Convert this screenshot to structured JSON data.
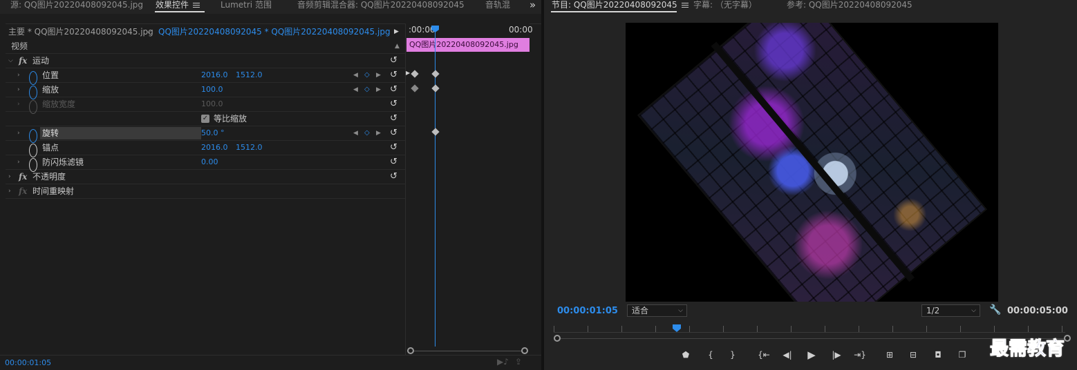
{
  "tabs_left": {
    "source": "源: QQ图片20220408092045.jpg",
    "effect_controls": "效果控件",
    "lumetri": "Lumetri 范围",
    "audio_clip_mixer": "音频剪辑混合器: QQ图片20220408092045",
    "audio_track": "音轨混",
    "overflow": "»"
  },
  "tabs_right": {
    "program": "节目: QQ图片20220408092045",
    "captions": "字幕: （无字幕）",
    "reference": "参考: QQ图片20220408092045"
  },
  "effect_header": {
    "master": "主要 * QQ图片20220408092045.jpg",
    "clip": "QQ图片20220408092045 * QQ图片20220408092045.jpg",
    "play": "▶",
    "time_start": ":00:00",
    "time_end": "00:00"
  },
  "video_section": "视频",
  "motion": {
    "label": "运动",
    "position": {
      "label": "位置",
      "x": "2016.0",
      "y": "1512.0"
    },
    "scale": {
      "label": "缩放",
      "value": "100.0"
    },
    "scale_width": {
      "label": "缩放宽度",
      "value": "100.0"
    },
    "uniform_scale": {
      "label": "等比缩放",
      "checked": true
    },
    "rotation": {
      "label": "旋转",
      "value": "50.0 °"
    },
    "anchor": {
      "label": "锚点",
      "x": "2016.0",
      "y": "1512.0"
    },
    "anti_flicker": {
      "label": "防闪烁滤镜",
      "value": "0.00"
    }
  },
  "opacity": {
    "label": "不透明度"
  },
  "time_remap": {
    "label": "时间重映射"
  },
  "mini_timeline": {
    "clip_name": "QQ图片20220408092045.jpg"
  },
  "effect_footer_time": "00:00:01:05",
  "program_monitor": {
    "current_time": "00:00:01:05",
    "fit": "适合",
    "resolution": "1/2",
    "duration": "00:00:05:00"
  },
  "controls": {
    "marker": "marker-icon",
    "in": "{",
    "out": "}",
    "go_in": "go-to-in-icon",
    "step_back": "step-back-icon",
    "play": "play-icon",
    "step_forward": "step-forward-icon",
    "go_out": "go-to-out-icon",
    "lift": "lift-icon",
    "extract": "extract-icon",
    "export_frame": "camera-icon",
    "compare": "compare-icon"
  },
  "watermark": "最需教育",
  "colors": {
    "accent": "#2d8ceb",
    "clip": "#e07ee0",
    "panel": "#1d1d1d"
  }
}
